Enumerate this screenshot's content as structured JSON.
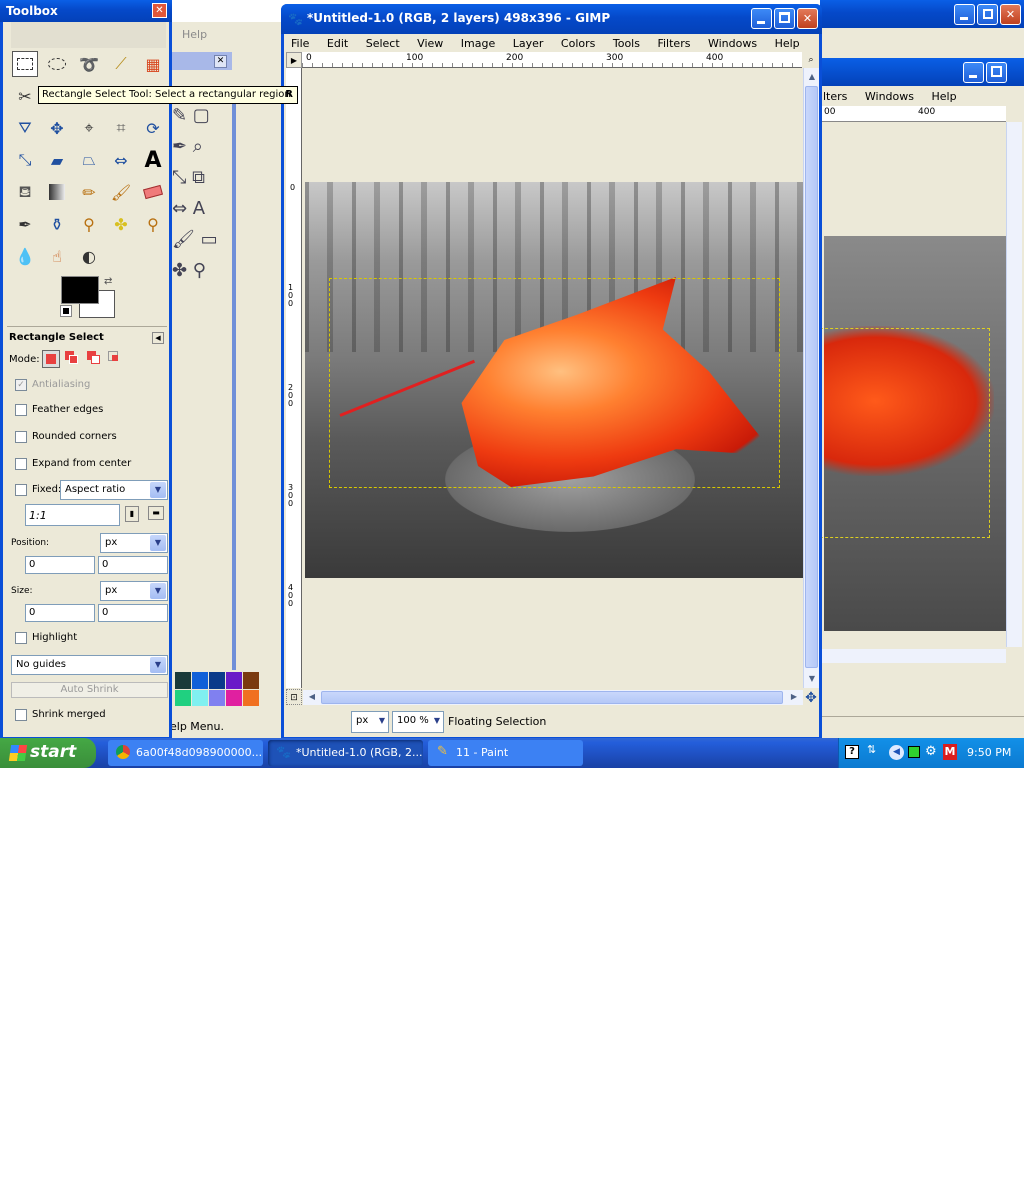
{
  "toolbox": {
    "title": "Toolbox",
    "tooltip": "Rectangle Select Tool: Select a rectangular region",
    "tooltip_key": "R",
    "options_title": "Rectangle Select",
    "mode_label": "Mode:",
    "antialiasing": "Antialiasing",
    "feather_edges": "Feather edges",
    "rounded_corners": "Rounded corners",
    "expand_from_center": "Expand from center",
    "fixed_label": "Fixed:",
    "fixed_value": "Aspect ratio",
    "ratio_value": "1:1",
    "position_label": "Position:",
    "position_unit": "px",
    "position_x": "0",
    "position_y": "0",
    "size_label": "Size:",
    "size_unit": "px",
    "size_w": "0",
    "size_h": "0",
    "highlight": "Highlight",
    "guides_value": "No guides",
    "auto_shrink": "Auto Shrink",
    "shrink_merged": "Shrink merged"
  },
  "main_window": {
    "title": "*Untitled-1.0 (RGB, 2 layers) 498x396 - GIMP",
    "menu": [
      "File",
      "Edit",
      "Select",
      "View",
      "Image",
      "Layer",
      "Colors",
      "Tools",
      "Filters",
      "Windows",
      "Help"
    ],
    "ruler_top": [
      "0",
      "100",
      "200",
      "300",
      "400"
    ],
    "ruler_left": [
      "0",
      "100",
      "200",
      "300",
      "400"
    ],
    "unit": "px",
    "zoom": "100 %",
    "status": "Floating Selection"
  },
  "bg_window": {
    "menu": [
      "lters",
      "Windows",
      "Help"
    ],
    "ruler": [
      "00",
      "400"
    ],
    "help_fragment": "Help",
    "status_fragment": "elp Menu."
  },
  "taskbar": {
    "start": "start",
    "items": [
      "6a00f48d098900000...",
      "*Untitled-1.0 (RGB, 2...",
      "11 - Paint"
    ],
    "clock": "9:50 PM"
  }
}
